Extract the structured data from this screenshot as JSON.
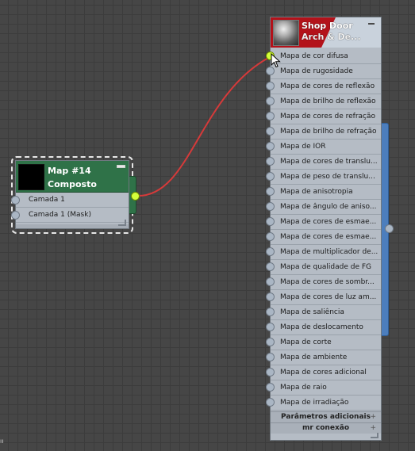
{
  "map_node": {
    "title_line1": "Map #14",
    "title_line2": "Composto",
    "slots": [
      "Camada 1",
      "Camada 1 (Mask)"
    ]
  },
  "material_node": {
    "title_line1": "Shop Door",
    "title_line2": "Arch & De...",
    "slots": [
      "Mapa de cor difusa",
      "Mapa de rugosidade",
      "Mapa de cores de reflexão",
      "Mapa de brilho de reflexão",
      "Mapa de cores de refração",
      "Mapa de brilho de refração",
      "Mapa de IOR",
      "Mapa de cores de translu...",
      "Mapa de peso de translu...",
      "Mapa de anisotropia",
      "Mapa de ângulo de aniso...",
      "Mapa de cores de esmae...",
      "Mapa de cores de esmae...",
      "Mapa de multiplicador de...",
      "Mapa de qualidade de FG",
      "Mapa de cores de sombr...",
      "Mapa de cores de luz am...",
      "Mapa de saliência",
      "Mapa de deslocamento",
      "Mapa de corte",
      "Mapa de ambiente",
      "Mapa de cores adicional",
      "Mapa de raio",
      "Mapa de irradiação"
    ],
    "rollouts": [
      "Parâmetros adicionais",
      "mr conexão"
    ],
    "rollout_icon": "+"
  },
  "colors": {
    "map_header": "#2f7248",
    "material_header_red": "#b3121a",
    "wire": "#d63a3a",
    "active_socket": "#d4ff3b",
    "side_tab": "#4c7ebd"
  },
  "corner_mark": "ıı"
}
